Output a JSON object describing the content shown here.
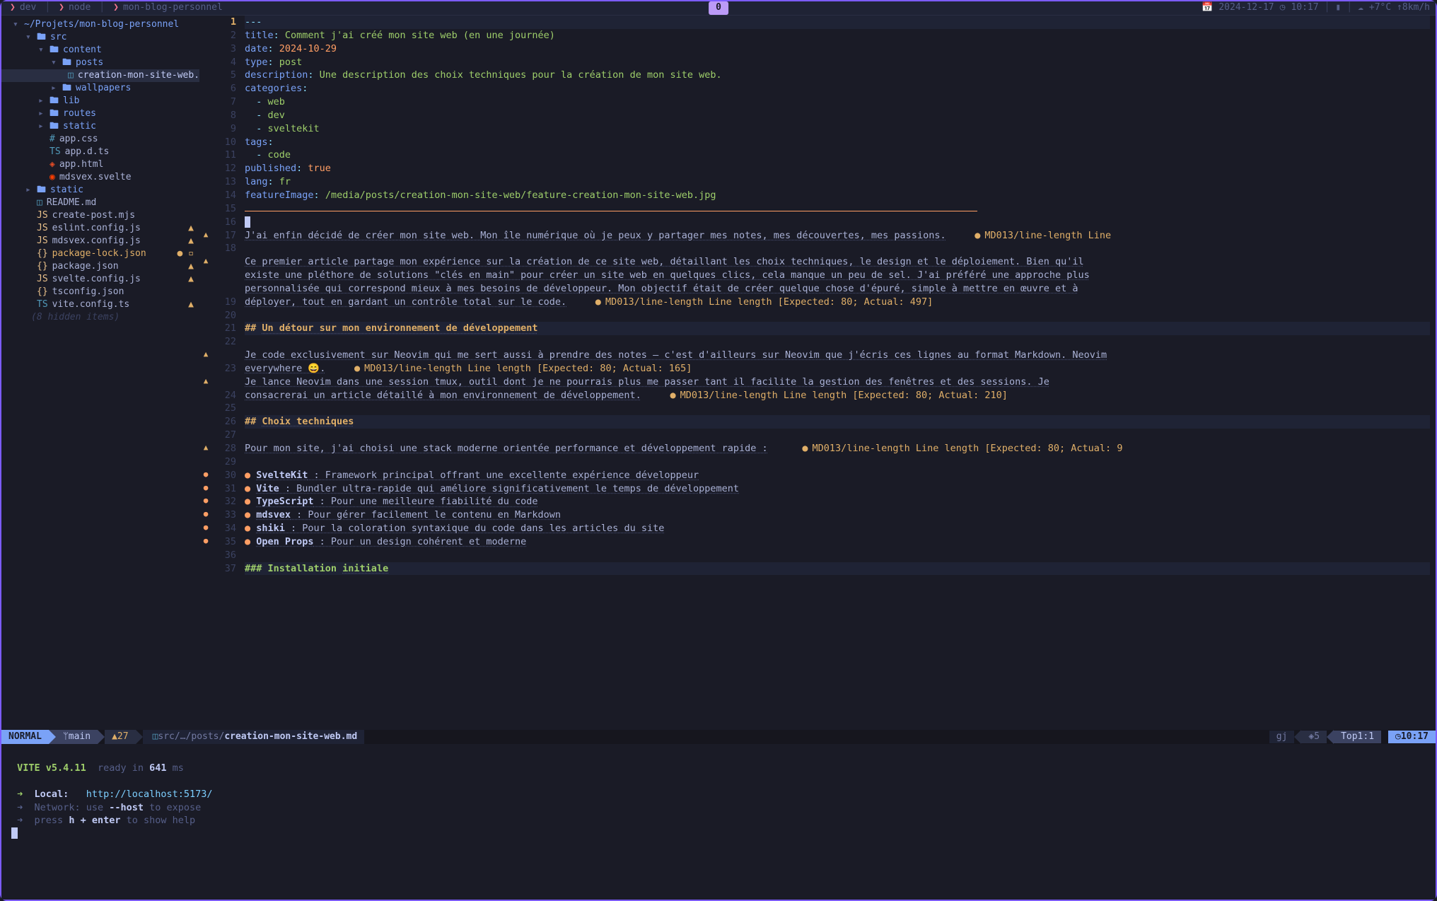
{
  "titlebar": {
    "tabs": [
      "dev",
      "node",
      "mon-blog-personnel"
    ],
    "badge": "0",
    "date": "2024-12-17",
    "time": "10:17",
    "weather": "+7°C ↑8km/h"
  },
  "sidebar": {
    "root": "~/Projets/mon-blog-personnel",
    "hidden_note": "(8 hidden items)",
    "tree": [
      {
        "depth": 1,
        "type": "folder",
        "open": true,
        "name": "src"
      },
      {
        "depth": 2,
        "type": "folder",
        "open": true,
        "name": "content"
      },
      {
        "depth": 3,
        "type": "folder",
        "open": true,
        "name": "posts"
      },
      {
        "depth": 4,
        "type": "file",
        "icon": "md",
        "name": "creation-mon-site-web.md",
        "active": true,
        "warn": true
      },
      {
        "depth": 3,
        "type": "folder",
        "open": false,
        "name": "wallpapers"
      },
      {
        "depth": 2,
        "type": "folder",
        "open": false,
        "name": "lib"
      },
      {
        "depth": 2,
        "type": "folder",
        "open": false,
        "name": "routes"
      },
      {
        "depth": 2,
        "type": "folder",
        "open": false,
        "name": "static"
      },
      {
        "depth": 2,
        "type": "file",
        "icon": "css",
        "name": "app.css"
      },
      {
        "depth": 2,
        "type": "file",
        "icon": "ts",
        "name": "app.d.ts"
      },
      {
        "depth": 2,
        "type": "file",
        "icon": "html",
        "name": "app.html"
      },
      {
        "depth": 2,
        "type": "file",
        "icon": "svelte",
        "name": "mdsvex.svelte"
      },
      {
        "depth": 1,
        "type": "folder",
        "open": false,
        "name": "static"
      },
      {
        "depth": 1,
        "type": "file",
        "icon": "md",
        "name": "README.md"
      },
      {
        "depth": 1,
        "type": "file",
        "icon": "js",
        "name": "create-post.mjs"
      },
      {
        "depth": 1,
        "type": "file",
        "icon": "js",
        "name": "eslint.config.js",
        "warn": true
      },
      {
        "depth": 1,
        "type": "file",
        "icon": "js",
        "name": "mdsvex.config.js",
        "warn": true
      },
      {
        "depth": 1,
        "type": "file",
        "icon": "json",
        "name": "package-lock.json",
        "mod": true,
        "color": "#e0af68"
      },
      {
        "depth": 1,
        "type": "file",
        "icon": "json",
        "name": "package.json",
        "warn": true
      },
      {
        "depth": 1,
        "type": "file",
        "icon": "js",
        "name": "svelte.config.js",
        "warn": true
      },
      {
        "depth": 1,
        "type": "file",
        "icon": "json",
        "name": "tsconfig.json"
      },
      {
        "depth": 1,
        "type": "file",
        "icon": "ts",
        "name": "vite.config.ts",
        "warn": true
      }
    ]
  },
  "editor": {
    "lines": {
      "l1": "---",
      "l2_k": "title",
      "l2_v": "Comment j'ai créé mon site web (en une journée)",
      "l3_k": "date",
      "l3_v": "2024-10-29",
      "l4_k": "type",
      "l4_v": "post",
      "l5_k": "description",
      "l5_v": "Une description des choix techniques pour la création de mon site web.",
      "l6_k": "categories",
      "l7": "web",
      "l8": "dev",
      "l9": "sveltekit",
      "l10_k": "tags",
      "l11": "code",
      "l12_k": "published",
      "l12_v": "true",
      "l13_k": "lang",
      "l13_v": "fr",
      "l14_k": "featureImage",
      "l14_v": "/media/posts/creation-mon-site-web/feature-creation-mon-site-web.jpg",
      "l17": "J'ai enfin décidé de créer mon site web. Mon île numérique où je peux y partager mes notes, mes découvertes, mes passions.",
      "l17_diag": "MD013/line-length Line",
      "l19a": "Ce premier article partage mon expérience sur la création de ce site web, détaillant les choix techniques, le design et le déploiement. Bien qu'il",
      "l19b": "existe une pléthore de solutions \"clés en main\" pour créer un site web en quelques clics, cela manque un peu de sel. J'ai préféré une approche plus",
      "l19c": "personnalisée qui correspond mieux à mes besoins de développeur. Mon objectif était de créer quelque chose d'épuré, simple à mettre en œuvre et à",
      "l19d": "déployer, tout en gardant un contrôle total sur le code.",
      "l19d_diag": "MD013/line-length Line length [Expected: 80; Actual: 497]",
      "l21_h": "## Un détour sur mon environnement de développement",
      "l23a": "Je code exclusivement sur Neovim qui me sert aussi à prendre des notes — c'est d'ailleurs sur Neovim que j'écris ces lignes au format Markdown. Neovim",
      "l23b": "everywhere 😄.",
      "l23b_diag": "MD013/line-length Line length [Expected: 80; Actual: 165]",
      "l24a": "Je lance Neovim dans une session tmux, outil dont je ne pourrais plus me passer tant il facilite la gestion des fenêtres et des sessions. Je",
      "l24b": "consacrerai un article détaillé à mon environnement de développement.",
      "l24b_diag": "MD013/line-length Line length [Expected: 80; Actual: 210]",
      "l26_h": "## Choix techniques",
      "l28": "Pour mon site, j'ai choisi une stack moderne orientée performance et développement rapide :",
      "l28_diag": "MD013/line-length Line length [Expected: 80; Actual: 9",
      "l30_b": "SvelteKit",
      "l30_t": " : Framework principal offrant une excellente expérience développeur",
      "l31_b": "Vite",
      "l31_t": " : Bundler ultra-rapide qui améliore significativement le temps de développement",
      "l32_b": "TypeScript",
      "l32_t": " : Pour une meilleure fiabilité du code",
      "l33_b": "mdsvex",
      "l33_t": " : Pour gérer facilement le contenu en Markdown",
      "l34_b": "shiki",
      "l34_t": " : Pour la coloration syntaxique du code dans les articles du site",
      "l35_b": "Open Props",
      "l35_t": " : Pour un design cohérent et moderne",
      "l37_h": "### Installation initiale"
    },
    "linenumbers": [
      1,
      2,
      3,
      4,
      5,
      6,
      7,
      8,
      9,
      10,
      11,
      12,
      13,
      14,
      15,
      16,
      17,
      18,
      19,
      20,
      21,
      22,
      23,
      24,
      25,
      26,
      27,
      28,
      29,
      30,
      31,
      32,
      33,
      34,
      35,
      36,
      37
    ],
    "signs": {
      "16": "▲",
      "18": "▲",
      "22": "▲",
      "23": "▲",
      "27": "▲",
      "29": "●",
      "30": "●",
      "31": "●",
      "32": "●",
      "33": "●",
      "34": "●"
    }
  },
  "statusline": {
    "mode": "NORMAL",
    "branch": "main",
    "warnings": "27",
    "path_prefix": "src/…/posts/",
    "filename": "creation-mon-site-web.md",
    "enc": "gj",
    "hints": "5",
    "scroll": "Top",
    "pos": "1:1",
    "time": "10:17"
  },
  "terminal": {
    "vite_label": "VITE",
    "vite_ver": "v5.4.11",
    "ready_pre": "ready in",
    "ready_ms": "641",
    "ready_suf": "ms",
    "local_label": "Local:",
    "local_url": "http://localhost:5173/",
    "network": "Network: use --host to expose",
    "help": "press h + enter to show help"
  }
}
